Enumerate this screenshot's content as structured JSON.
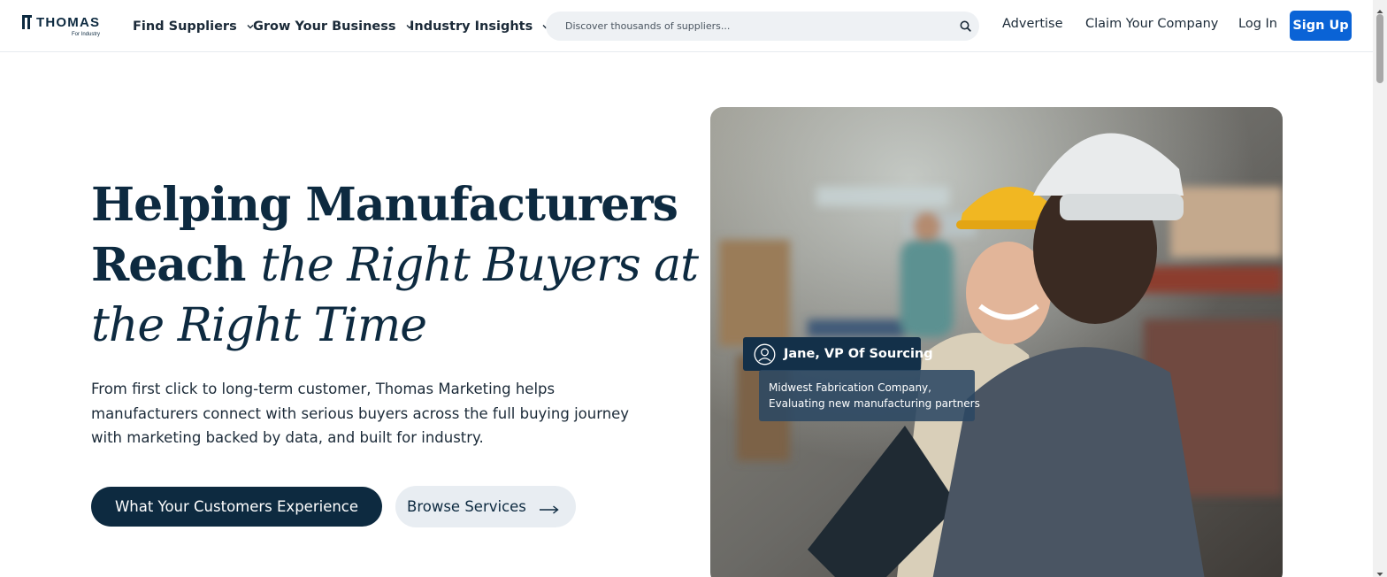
{
  "logo": {
    "wordmark": "THOMAS",
    "tagline": "For Industry"
  },
  "nav": {
    "items": [
      {
        "label": "Find Suppliers"
      },
      {
        "label": "Grow Your Business"
      },
      {
        "label": "Industry Insights"
      }
    ],
    "links": {
      "advertise": "Advertise",
      "claim": "Claim Your Company",
      "login": "Log In",
      "signup": "Sign Up"
    }
  },
  "search": {
    "placeholder": "Discover thousands of suppliers..."
  },
  "hero": {
    "headline_bold_1": "Helping Manufacturers",
    "headline_bold_2": "Reach",
    "headline_italic_2": "the Right Buyers at",
    "headline_italic_3": "the Right Time",
    "description": "From first click to long-term customer, Thomas Marketing helps manufacturers connect with serious buyers across the full buying journey with marketing backed by data, and built for industry.",
    "cta_primary": "What Your Customers Experience",
    "cta_secondary": "Browse Services"
  },
  "persona": {
    "name": "Jane, VP Of Sourcing",
    "company": "Midwest Fabrication Company,",
    "activity": "Evaluating new manufacturing partners"
  },
  "colors": {
    "navy": "#0d2a40",
    "brand_blue": "#0a63d6",
    "search_bg": "#eef1f4",
    "secondary_button_bg": "#e8edf2"
  }
}
